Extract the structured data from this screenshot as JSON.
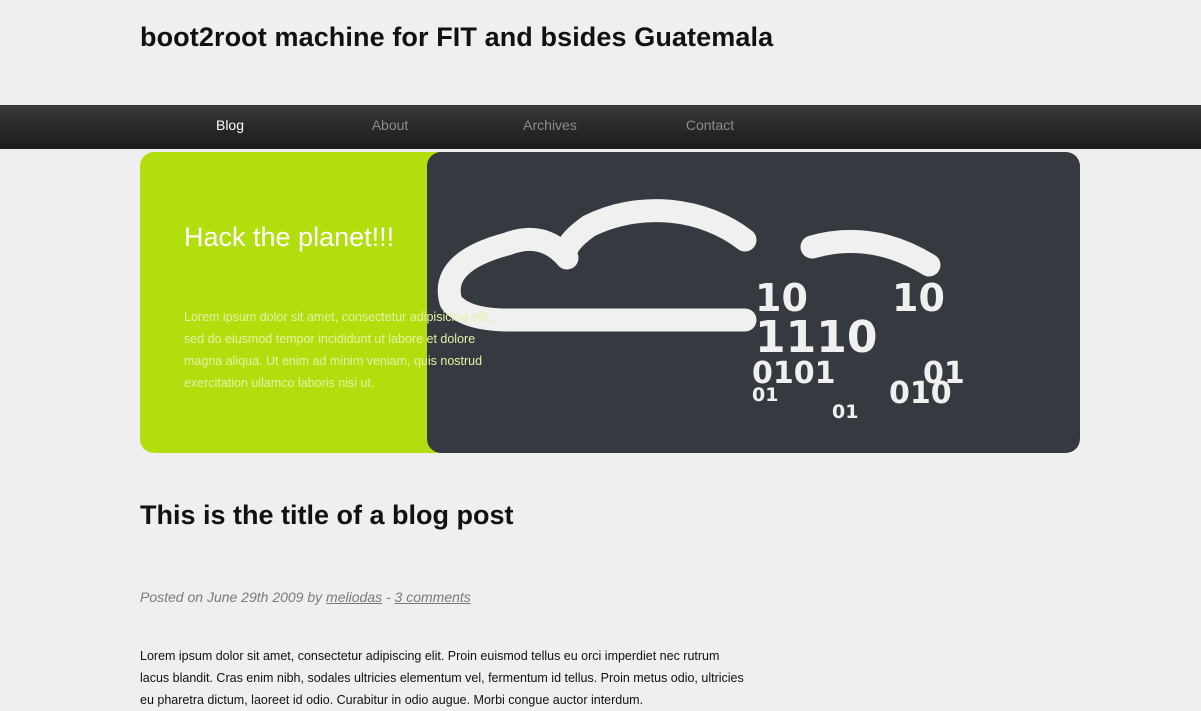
{
  "site": {
    "title": "boot2root machine for FIT and bsides Guatemala"
  },
  "nav": {
    "items": [
      {
        "label": "Blog",
        "active": true
      },
      {
        "label": "About",
        "active": false
      },
      {
        "label": "Archives",
        "active": false
      },
      {
        "label": "Contact",
        "active": false
      }
    ]
  },
  "hero": {
    "title": "Hack the planet!!!",
    "text": "Lorem ipsum dolor sit amet, consectetur adipisicing elit, sed do eiusmod tempor incididunt ut labore et dolore magna aliqua. Ut enim ad minim veniam, quis nostrud exercitation ullamco laboris nisi ut.",
    "image": {
      "icon": "cloud-binary-icon",
      "binary_rows": [
        "10",
        "10",
        "1110",
        "0101",
        "01",
        "01",
        "010",
        "01"
      ]
    },
    "colors": {
      "panel": "#b2de0d",
      "image_bg": "#343a40"
    }
  },
  "post": {
    "title": "This is the title of a blog post",
    "meta": {
      "posted_prefix": "Posted on June 29th 2009 by ",
      "author": "meliodas",
      "separator": " - ",
      "comments": "3 comments"
    },
    "body": "Lorem ipsum dolor sit amet, consectetur adipiscing elit. Proin euismod tellus eu orci imperdiet nec rutrum lacus blandit. Cras enim nibh, sodales ultricies elementum vel, fermentum id tellus. Proin metus odio, ultricies eu pharetra dictum, laoreet id odio. Curabitur in odio augue. Morbi congue auctor interdum."
  }
}
